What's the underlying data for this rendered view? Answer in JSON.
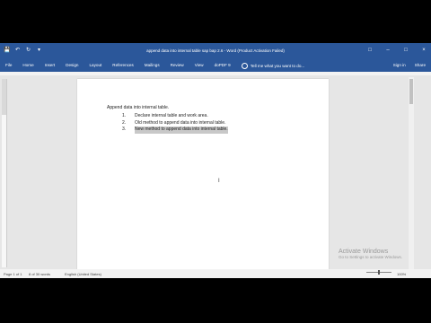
{
  "window": {
    "title": "append data into internal table sap bap 2.6 - Word (Product Activation Failed)",
    "controls": [
      "?",
      "□",
      "–",
      "□",
      "×"
    ]
  },
  "qat": {
    "save": "💾",
    "undo": "↶",
    "redo": "↻",
    "more": "▾"
  },
  "ribbon": {
    "tabs": [
      "File",
      "Home",
      "Insert",
      "Design",
      "Layout",
      "References",
      "Mailings",
      "Review",
      "View",
      "doPDF 9"
    ],
    "tell_me": "Tell me what you want to do...",
    "sign_in": "Sign in",
    "share": "Share"
  },
  "document": {
    "heading": "Append data into internal table.",
    "list": [
      {
        "num": "1.",
        "text": "Declare internal table and work area."
      },
      {
        "num": "2.",
        "text": "Old method to append data into internal table."
      },
      {
        "num": "3.",
        "text": "New method to append data into internal table."
      }
    ]
  },
  "status": {
    "page": "Page 1 of 1",
    "words": "8 of 30 words",
    "language": "English (United States)",
    "zoom": "100%"
  },
  "watermark": {
    "title": "Activate Windows",
    "subtitle": "Go to Settings to activate Windows."
  }
}
